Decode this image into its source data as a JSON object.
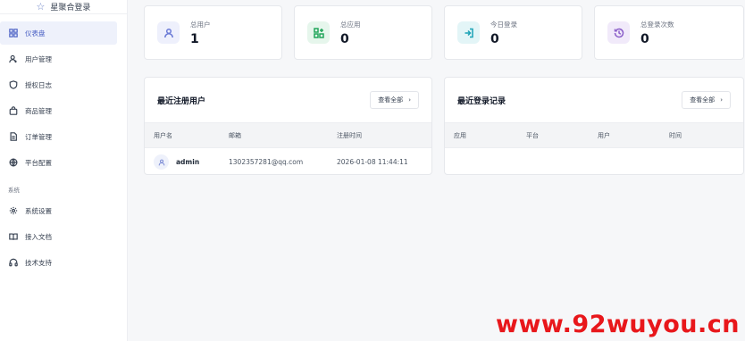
{
  "brand": {
    "name": "星聚合登录"
  },
  "sidebar": {
    "items": [
      {
        "label": "仪表盘",
        "icon": "dashboard-icon"
      },
      {
        "label": "用户管理",
        "icon": "user-manage-icon"
      },
      {
        "label": "授权日志",
        "icon": "shield-icon"
      },
      {
        "label": "商品管理",
        "icon": "bag-icon"
      },
      {
        "label": "订单管理",
        "icon": "document-icon"
      },
      {
        "label": "平台配置",
        "icon": "globe-icon"
      }
    ],
    "section_system": "系统",
    "system_items": [
      {
        "label": "系统设置",
        "icon": "gear-icon"
      },
      {
        "label": "接入文档",
        "icon": "book-icon"
      },
      {
        "label": "技术支持",
        "icon": "headset-icon"
      }
    ]
  },
  "stats": [
    {
      "label": "总用户",
      "value": "1",
      "icon": "user-icon",
      "color": "#6b7bd6",
      "bg": "#eef0fc"
    },
    {
      "label": "总应用",
      "value": "0",
      "icon": "apps-icon",
      "color": "#22a55b",
      "bg": "#e6f6ec"
    },
    {
      "label": "今日登录",
      "value": "0",
      "icon": "login-icon",
      "color": "#1aa2b5",
      "bg": "#e3f5f7"
    },
    {
      "label": "总登录次数",
      "value": "0",
      "icon": "history-icon",
      "color": "#8b5fc9",
      "bg": "#f1eafa"
    }
  ],
  "recent_users": {
    "title": "最近注册用户",
    "view_all": "查看全部",
    "columns": [
      "用户名",
      "邮箱",
      "注册时间"
    ],
    "rows": [
      {
        "username": "admin",
        "email": "1302357281@qq.com",
        "registered": "2026-01-08 11:44:11"
      }
    ]
  },
  "recent_logins": {
    "title": "最近登录记录",
    "view_all": "查看全部",
    "columns": [
      "应用",
      "平台",
      "用户",
      "时间"
    ]
  },
  "watermark": "www.92wuyou.cn",
  "colors": {
    "accent": "#4a60c4",
    "watermark": "#e8171b"
  }
}
